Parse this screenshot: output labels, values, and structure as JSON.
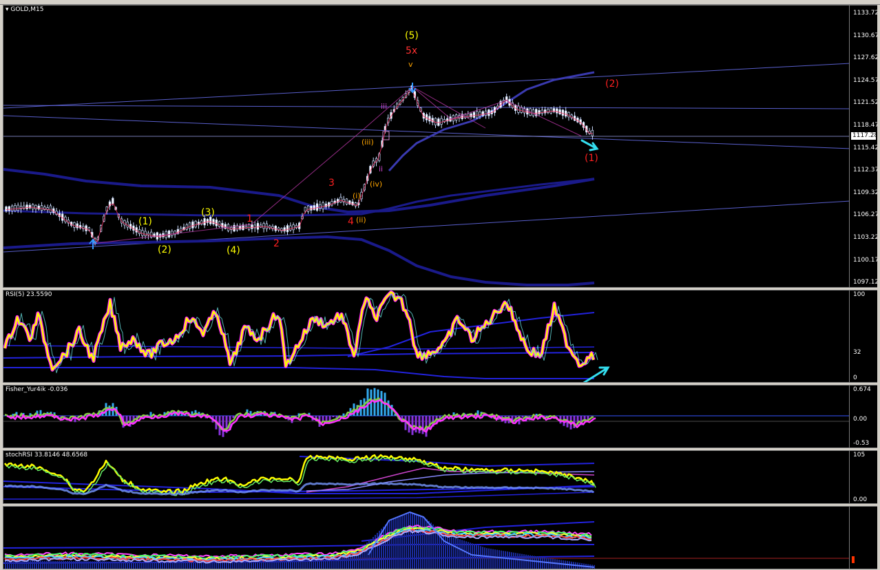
{
  "panes": {
    "main": {
      "label": "GOLD,M15",
      "ticks": [
        "1133.72",
        "1130.67",
        "1127.62",
        "1124.57",
        "1121.52",
        "1118.47",
        "1115.42",
        "1112.37",
        "1109.32",
        "1106.27",
        "1103.22",
        "1100.17",
        "1097.12"
      ],
      "current_price": "1117.28"
    },
    "rsi": {
      "label": "RSI(5) 23.5590",
      "ticks": [
        "100",
        "32",
        "0"
      ]
    },
    "fisher": {
      "label": "Fisher_Yur4ik -0.036",
      "ticks": [
        "0.674",
        "0.00",
        "-0.53"
      ]
    },
    "stoch": {
      "label": "stochRSI 33.8146 48.6568",
      "ticks": [
        "105",
        "0.00"
      ]
    }
  },
  "wave_labels": {
    "yellow": [
      "(5)",
      "(1)",
      "(2)",
      "(3)",
      "(4)"
    ],
    "red": [
      "5x",
      "(2)",
      "(1)",
      "1",
      "2",
      "3",
      "4"
    ],
    "orange": [
      "v",
      "iii",
      "ii",
      "(iii)",
      "(iv)",
      "(i)",
      "(ii)"
    ]
  },
  "colors": {
    "background": "#000000",
    "yellow": "#ffff00",
    "red": "#ff2020",
    "orange": "#ffa500",
    "magenta": "#ff22ff",
    "cyan_arrow": "#33ddee",
    "navy_line": "#1a1a8a",
    "grid_line": "#6f77ff"
  }
}
